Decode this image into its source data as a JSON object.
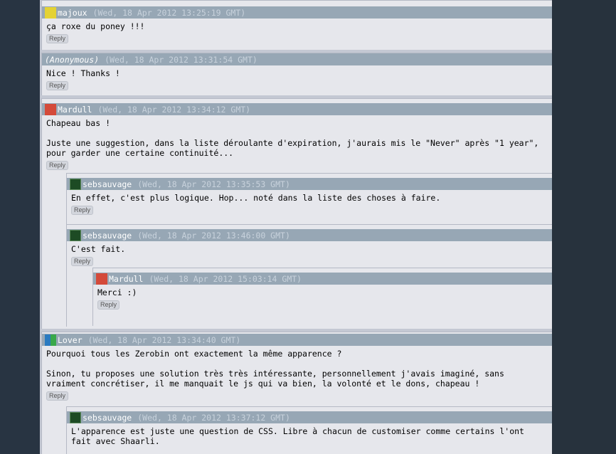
{
  "reply_label": "Reply",
  "comments": [
    {
      "nick": "majoux",
      "date": "(Wed, 18 Apr 2012 13:25:19 GMT)",
      "lines": [
        "ça roxe du poney !!!"
      ]
    },
    {
      "nick": "(Anonymous)",
      "date": "(Wed, 18 Apr 2012 13:31:54 GMT)",
      "lines": [
        "Nice ! Thanks !"
      ]
    },
    {
      "nick": "Mardull",
      "date": "(Wed, 18 Apr 2012 13:34:12 GMT)",
      "lines": [
        "Chapeau bas !",
        "",
        "Juste une suggestion, dans la liste déroulante d'expiration, j'aurais mis le \"Never\" après \"1 year\",",
        "pour garder une certaine continuité..."
      ]
    },
    {
      "nick": "sebsauvage",
      "date": "(Wed, 18 Apr 2012 13:35:53 GMT)",
      "lines": [
        "En effet, c'est plus logique. Hop... noté dans la liste des choses à faire."
      ]
    },
    {
      "nick": "sebsauvage",
      "date": "(Wed, 18 Apr 2012 13:46:00 GMT)",
      "lines": [
        "C'est fait."
      ]
    },
    {
      "nick": "Mardull",
      "date": "(Wed, 18 Apr 2012 15:03:14 GMT)",
      "lines": [
        "Merci :)"
      ]
    },
    {
      "nick": "Lover",
      "date": "(Wed, 18 Apr 2012 13:34:40 GMT)",
      "lines": [
        "Pourquoi tous les Zerobin ont exactement la même apparence ?",
        "",
        "Sinon, tu proposes une solution très très intéressante, personnellement j'avais imaginé, sans",
        "vraiment concrétiser, il me manquait le js qui va bien, la volonté et le dons, chapeau !"
      ]
    },
    {
      "nick": "sebsauvage",
      "date": "(Wed, 18 Apr 2012 13:37:12 GMT)",
      "lines": [
        "L'apparence est juste une question de CSS. Libre à chacun de customiser comme certains l'ont",
        "fait avec Shaarli."
      ]
    }
  ]
}
